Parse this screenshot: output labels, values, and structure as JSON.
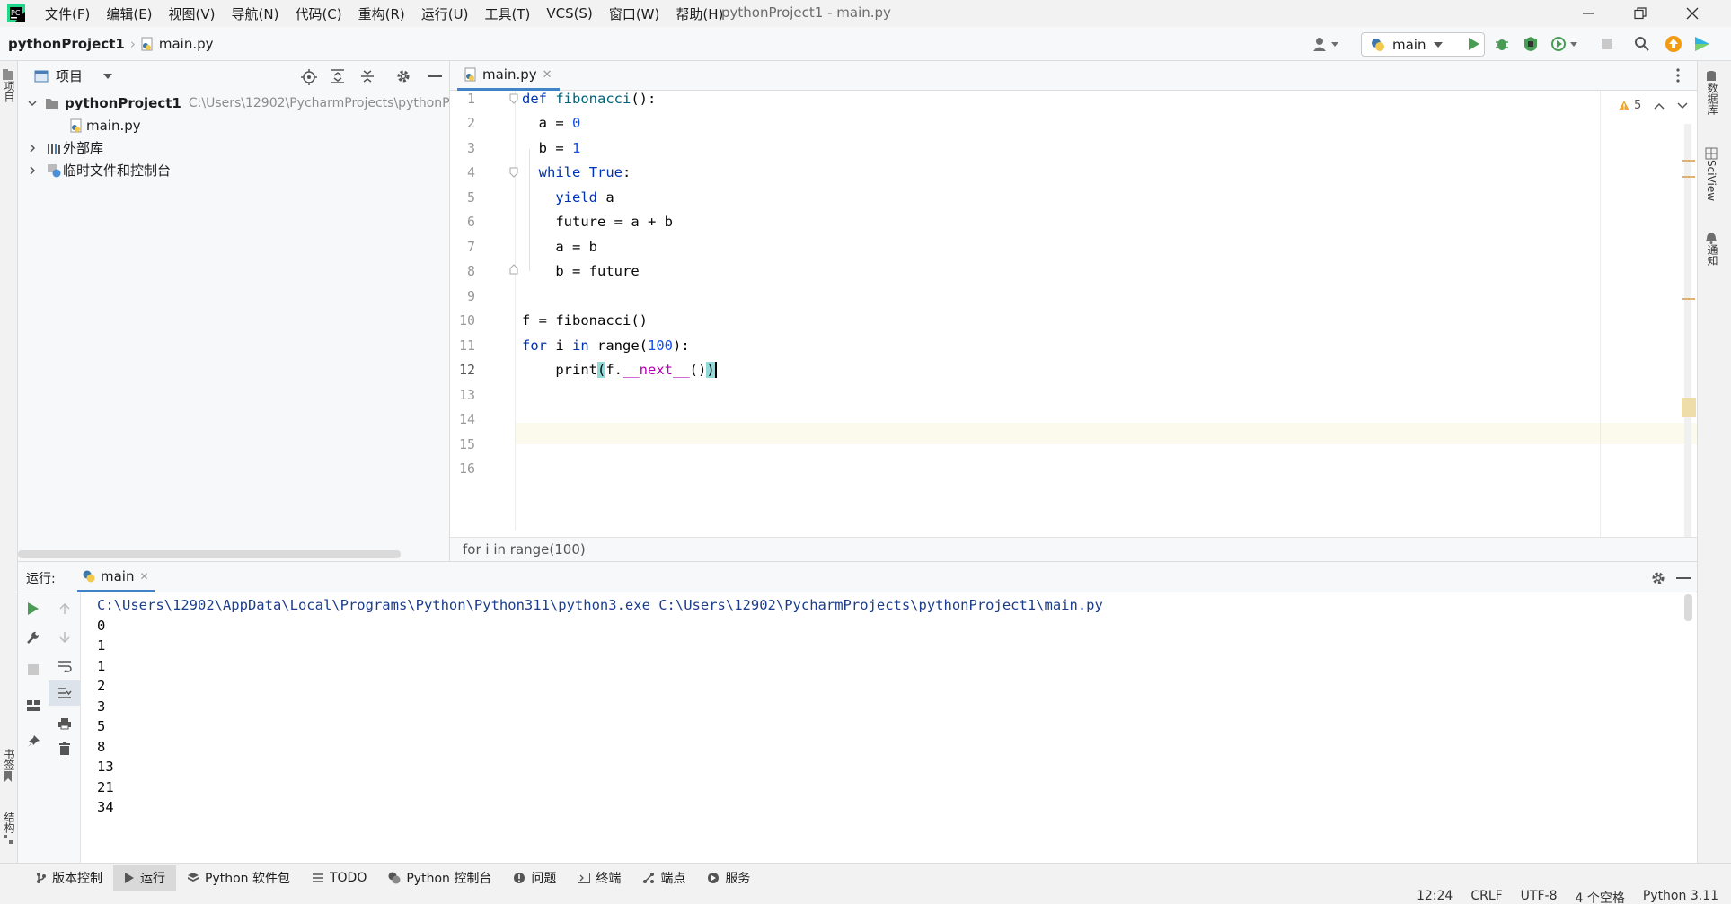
{
  "menu": [
    "文件(F)",
    "编辑(E)",
    "视图(V)",
    "导航(N)",
    "代码(C)",
    "重构(R)",
    "运行(U)",
    "工具(T)",
    "VCS(S)",
    "窗口(W)",
    "帮助(H)"
  ],
  "window_title": "pythonProject1 - main.py",
  "breadcrumb": {
    "project": "pythonProject1",
    "file": "main.py"
  },
  "run_config": "main",
  "left_strip": {
    "project_label": "项目",
    "bookmarks_label": "书签",
    "structure_label": "结构"
  },
  "right_strip": {
    "db_label": "数据库",
    "sciview_label": "SciView",
    "notify_label": "通知"
  },
  "project_panel": {
    "title": "项目",
    "root_name": "pythonProject1",
    "root_path": "C:\\Users\\12902\\PycharmProjects\\pythonP",
    "file": "main.py",
    "external_libs": "外部库",
    "scratches": "临时文件和控制台"
  },
  "editor": {
    "tab": "main.py",
    "warnings": "5",
    "line_numbers": [
      "1",
      "2",
      "3",
      "4",
      "5",
      "6",
      "7",
      "8",
      "9",
      "10",
      "11",
      "12",
      "13",
      "14",
      "15",
      "16"
    ],
    "footer": "for i in range(100)"
  },
  "run": {
    "label": "运行:",
    "tab": "main",
    "command": "C:\\Users\\12902\\AppData\\Local\\Programs\\Python\\Python311\\python3.exe C:\\Users\\12902\\PycharmProjects\\pythonProject1\\main.py",
    "output": [
      "0",
      "1",
      "1",
      "2",
      "3",
      "5",
      "8",
      "13",
      "21",
      "34"
    ]
  },
  "bottom_tabs": [
    "版本控制",
    "运行",
    "Python 软件包",
    "TODO",
    "Python 控制台",
    "问题",
    "终端",
    "端点",
    "服务"
  ],
  "status": {
    "position": "12:24",
    "line_sep": "CRLF",
    "encoding": "UTF-8",
    "indent": "4 个空格",
    "interpreter": "Python 3.11"
  },
  "colors": {
    "accent": "#4083c9",
    "run_green": "#499c54",
    "keyword": "#0033b3",
    "number": "#1750eb",
    "dunder": "#b200b2"
  }
}
